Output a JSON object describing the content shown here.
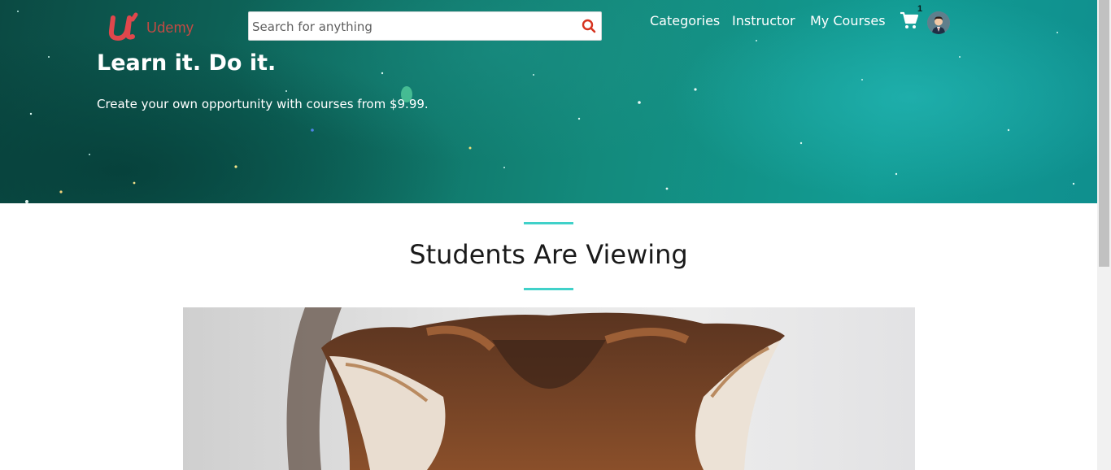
{
  "brand": {
    "logo_text": "Udemy",
    "accent": "#e0474c"
  },
  "search": {
    "placeholder": "Search for anything",
    "value": "",
    "icon": "search-icon"
  },
  "nav": {
    "items": [
      "Categories",
      "Instructor",
      "My Courses"
    ]
  },
  "cart": {
    "count": "1",
    "icon": "cart-icon"
  },
  "hero": {
    "title": "Learn it. Do it.",
    "subtitle": "Create your own opportunity with courses from $9.99."
  },
  "section": {
    "title": "Students Are Viewing",
    "rule_color": "#40d1c9"
  }
}
